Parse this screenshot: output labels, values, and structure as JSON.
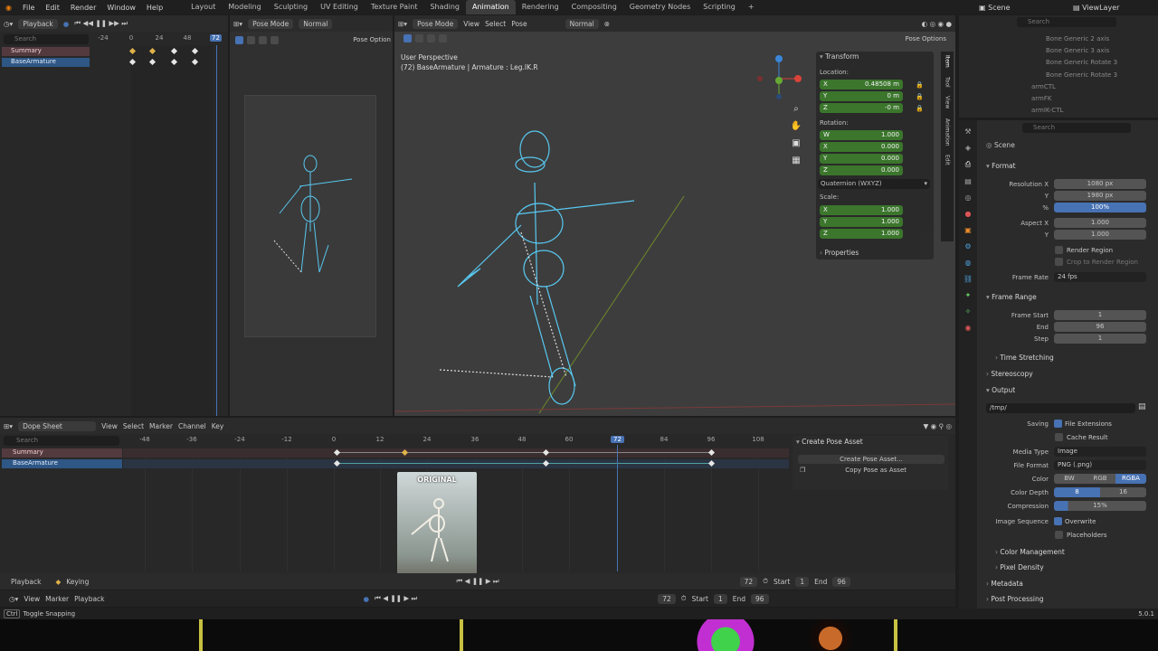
{
  "topbar": {
    "menus": [
      "File",
      "Edit",
      "Render",
      "Window",
      "Help"
    ],
    "workspaces": [
      "Layout",
      "Modeling",
      "Sculpting",
      "UV Editing",
      "Texture Paint",
      "Shading",
      "Animation",
      "Rendering",
      "Compositing",
      "Geometry Nodes",
      "Scripting"
    ],
    "active_workspace": "Animation",
    "add_tab": "+",
    "scene": "Scene",
    "view_layer": "ViewLayer"
  },
  "left_dopesheet": {
    "header": "Playback",
    "search_placeholder": "Search",
    "frame_current": "72",
    "ticks": [
      "-24",
      "0",
      "24",
      "48"
    ],
    "channels": [
      "Summary",
      "BaseArmature"
    ]
  },
  "pose_panel": {
    "header": "Pose Mode",
    "shading": "Normal",
    "pose_options": "Pose Option"
  },
  "viewport": {
    "header_mode": "Pose Mode",
    "menus": [
      "View",
      "Select",
      "Pose"
    ],
    "orientation": "Normal",
    "pose_options": "Pose Options",
    "overlay_title": "User Perspective",
    "overlay_sub": "(72) BaseArmature | Armature : Leg.IK.R"
  },
  "transform": {
    "title": "Transform",
    "location_label": "Location:",
    "location": [
      {
        "axis": "X",
        "value": "0.48508 m"
      },
      {
        "axis": "Y",
        "value": "0 m"
      },
      {
        "axis": "Z",
        "value": "-0 m"
      }
    ],
    "rotation_label": "Rotation:",
    "rotation": [
      {
        "axis": "W",
        "value": "1.000"
      },
      {
        "axis": "X",
        "value": "0.000"
      },
      {
        "axis": "Y",
        "value": "0.000"
      },
      {
        "axis": "Z",
        "value": "0.000"
      }
    ],
    "rotation_mode": "Quaternion (WXYZ)",
    "scale_label": "Scale:",
    "scale": [
      {
        "axis": "X",
        "value": "1.000"
      },
      {
        "axis": "Y",
        "value": "1.000"
      },
      {
        "axis": "Z",
        "value": "1.000"
      }
    ],
    "properties": "Properties",
    "tabs": [
      "Item",
      "Tool",
      "View",
      "Animation",
      "Edit"
    ]
  },
  "outliner": {
    "search_placeholder": "Search",
    "items": [
      "Bone Generic 2 axis",
      "Bone Generic 3 axis",
      "Bone Generic Rotate 3",
      "Bone Generic Rotate 3",
      "armCTL",
      "armFK",
      "armIK-CTL"
    ]
  },
  "properties": {
    "search_placeholder": "Search",
    "context": "Scene",
    "format": {
      "title": "Format",
      "rows": [
        {
          "label": "Resolution X",
          "value": "1080 px"
        },
        {
          "label": "Y",
          "value": "1980 px"
        },
        {
          "label": "%",
          "value": "100%"
        },
        {
          "label": "Aspect X",
          "value": "1.000"
        },
        {
          "label": "Y",
          "value": "1.000"
        }
      ],
      "render_region": "Render Region",
      "crop": "Crop to Render Region",
      "frame_rate_label": "Frame Rate",
      "frame_rate": "24 fps"
    },
    "frame_range": {
      "title": "Frame Range",
      "rows": [
        {
          "label": "Frame Start",
          "value": "1"
        },
        {
          "label": "End",
          "value": "96"
        },
        {
          "label": "Step",
          "value": "1"
        }
      ]
    },
    "time_stretching": "Time Stretching",
    "stereoscopy": "Stereoscopy",
    "output": {
      "title": "Output",
      "path": "/tmp/",
      "saving_label": "Saving",
      "file_extensions": "File Extensions",
      "cache_result": "Cache Result",
      "media_type_label": "Media Type",
      "media_type": "Image",
      "file_format_label": "File Format",
      "file_format": "PNG (.png)",
      "color_label": "Color",
      "color_options": [
        "BW",
        "RGB",
        "RGBA"
      ],
      "color_depth_label": "Color Depth",
      "color_depth": [
        "8",
        "16"
      ],
      "compression_label": "Compression",
      "compression": "15%",
      "image_sequence_label": "Image Sequence",
      "overwrite": "Overwrite",
      "placeholders": "Placeholders"
    },
    "color_management": "Color Management",
    "pixel_density": "Pixel Density",
    "metadata": "Metadata",
    "post_processing": "Post Processing"
  },
  "dopesheet": {
    "header_mode": "Dope Sheet",
    "menus": [
      "View",
      "Select",
      "Marker",
      "Channel",
      "Key"
    ],
    "search_placeholder": "Search",
    "ticks": [
      "-48",
      "-36",
      "-24",
      "-12",
      "0",
      "12",
      "24",
      "36",
      "48",
      "60",
      "72",
      "84",
      "96",
      "108"
    ],
    "current_frame": "72",
    "channels": [
      "Summary",
      "BaseArmature"
    ],
    "pose_asset_title": "Create Pose Asset",
    "create_pose_asset": "Create Pose Asset...",
    "copy_pose_asset": "Copy Pose as Asset",
    "thumbnail_label": "ORIGINAL"
  },
  "timeline1": {
    "playback": "Playback",
    "keying": "Keying",
    "frame": "72",
    "start_label": "Start",
    "start": "1",
    "end_label": "End",
    "end": "96"
  },
  "timeline2": {
    "menus": [
      "View",
      "Marker",
      "Playback"
    ],
    "frame": "72",
    "start_label": "Start",
    "start": "1",
    "end_label": "End",
    "end": "96"
  },
  "statusbar": {
    "hint_key": "Ctrl",
    "hint": "Toggle Snapping",
    "version": "5.0.1"
  },
  "colors": {
    "accent_blue": "#4772b3",
    "green_field": "#3b7a2c",
    "armature": "#55c8f0"
  }
}
